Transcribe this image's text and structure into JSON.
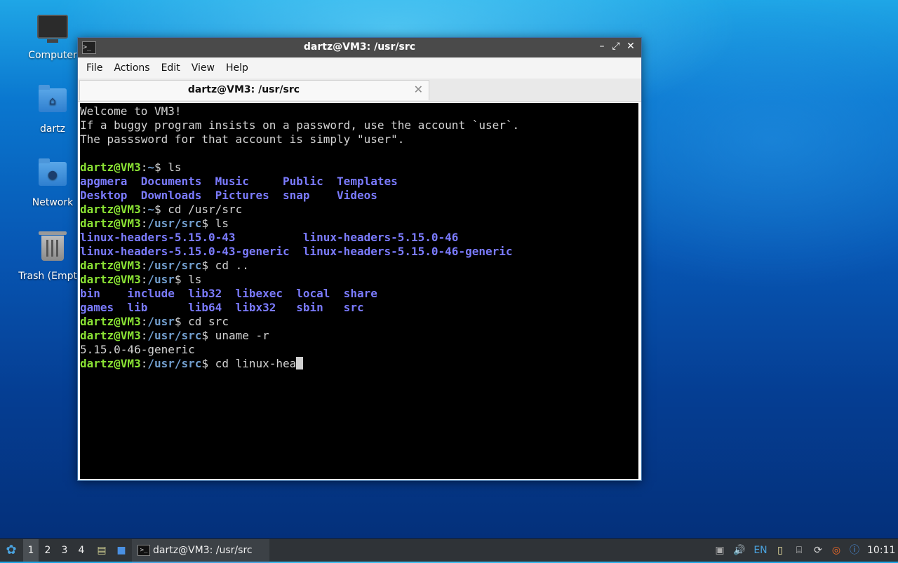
{
  "desktop": {
    "icons": [
      {
        "label": "Computer"
      },
      {
        "label": "dartz"
      },
      {
        "label": "Network"
      },
      {
        "label": "Trash (Empty)"
      }
    ]
  },
  "window": {
    "title": "dartz@VM3: /usr/src",
    "controls": {
      "minimize": "–",
      "maximize": "⤢",
      "close": "✕"
    },
    "menu": [
      "File",
      "Actions",
      "Edit",
      "View",
      "Help"
    ],
    "tab": {
      "title": "dartz@VM3: /usr/src",
      "close": "✕"
    }
  },
  "terminal": {
    "welcome": [
      "Welcome to VM3!",
      "If a buggy program insists on a password, use the account `user`.",
      "The passsword for that account is simply \"user\"."
    ],
    "prompt_user": "dartz@VM3",
    "lines": {
      "l1_path": "~",
      "l1_cmd": " ls",
      "ls1_row1": "apgmera  Documents  Music     Public  Templates",
      "ls1_row2": "Desktop  Downloads  Pictures  snap    Videos",
      "l2_path": "~",
      "l2_cmd": " cd /usr/src",
      "l3_path": "/usr/src",
      "l3_cmd": " ls",
      "ls2_row1": "linux-headers-5.15.0-43          linux-headers-5.15.0-46",
      "ls2_row2": "linux-headers-5.15.0-43-generic  linux-headers-5.15.0-46-generic",
      "l4_path": "/usr/src",
      "l4_cmd": " cd ..",
      "l5_path": "/usr",
      "l5_cmd": " ls",
      "ls3_row1": "bin    include  lib32  libexec  local  share",
      "ls3_row2": "games  lib      lib64  libx32   sbin   src",
      "l6_path": "/usr",
      "l6_cmd": " cd src",
      "l7_path": "/usr/src",
      "l7_cmd": " uname -r",
      "uname_out": "5.15.0-46-generic",
      "l8_path": "/usr/src",
      "l8_cmd": " cd linux-hea"
    }
  },
  "taskbar": {
    "workspaces": [
      "1",
      "2",
      "3",
      "4"
    ],
    "task_label": "dartz@VM3: /usr/src",
    "keyboard_layout": "EN",
    "clock": "10:11"
  }
}
